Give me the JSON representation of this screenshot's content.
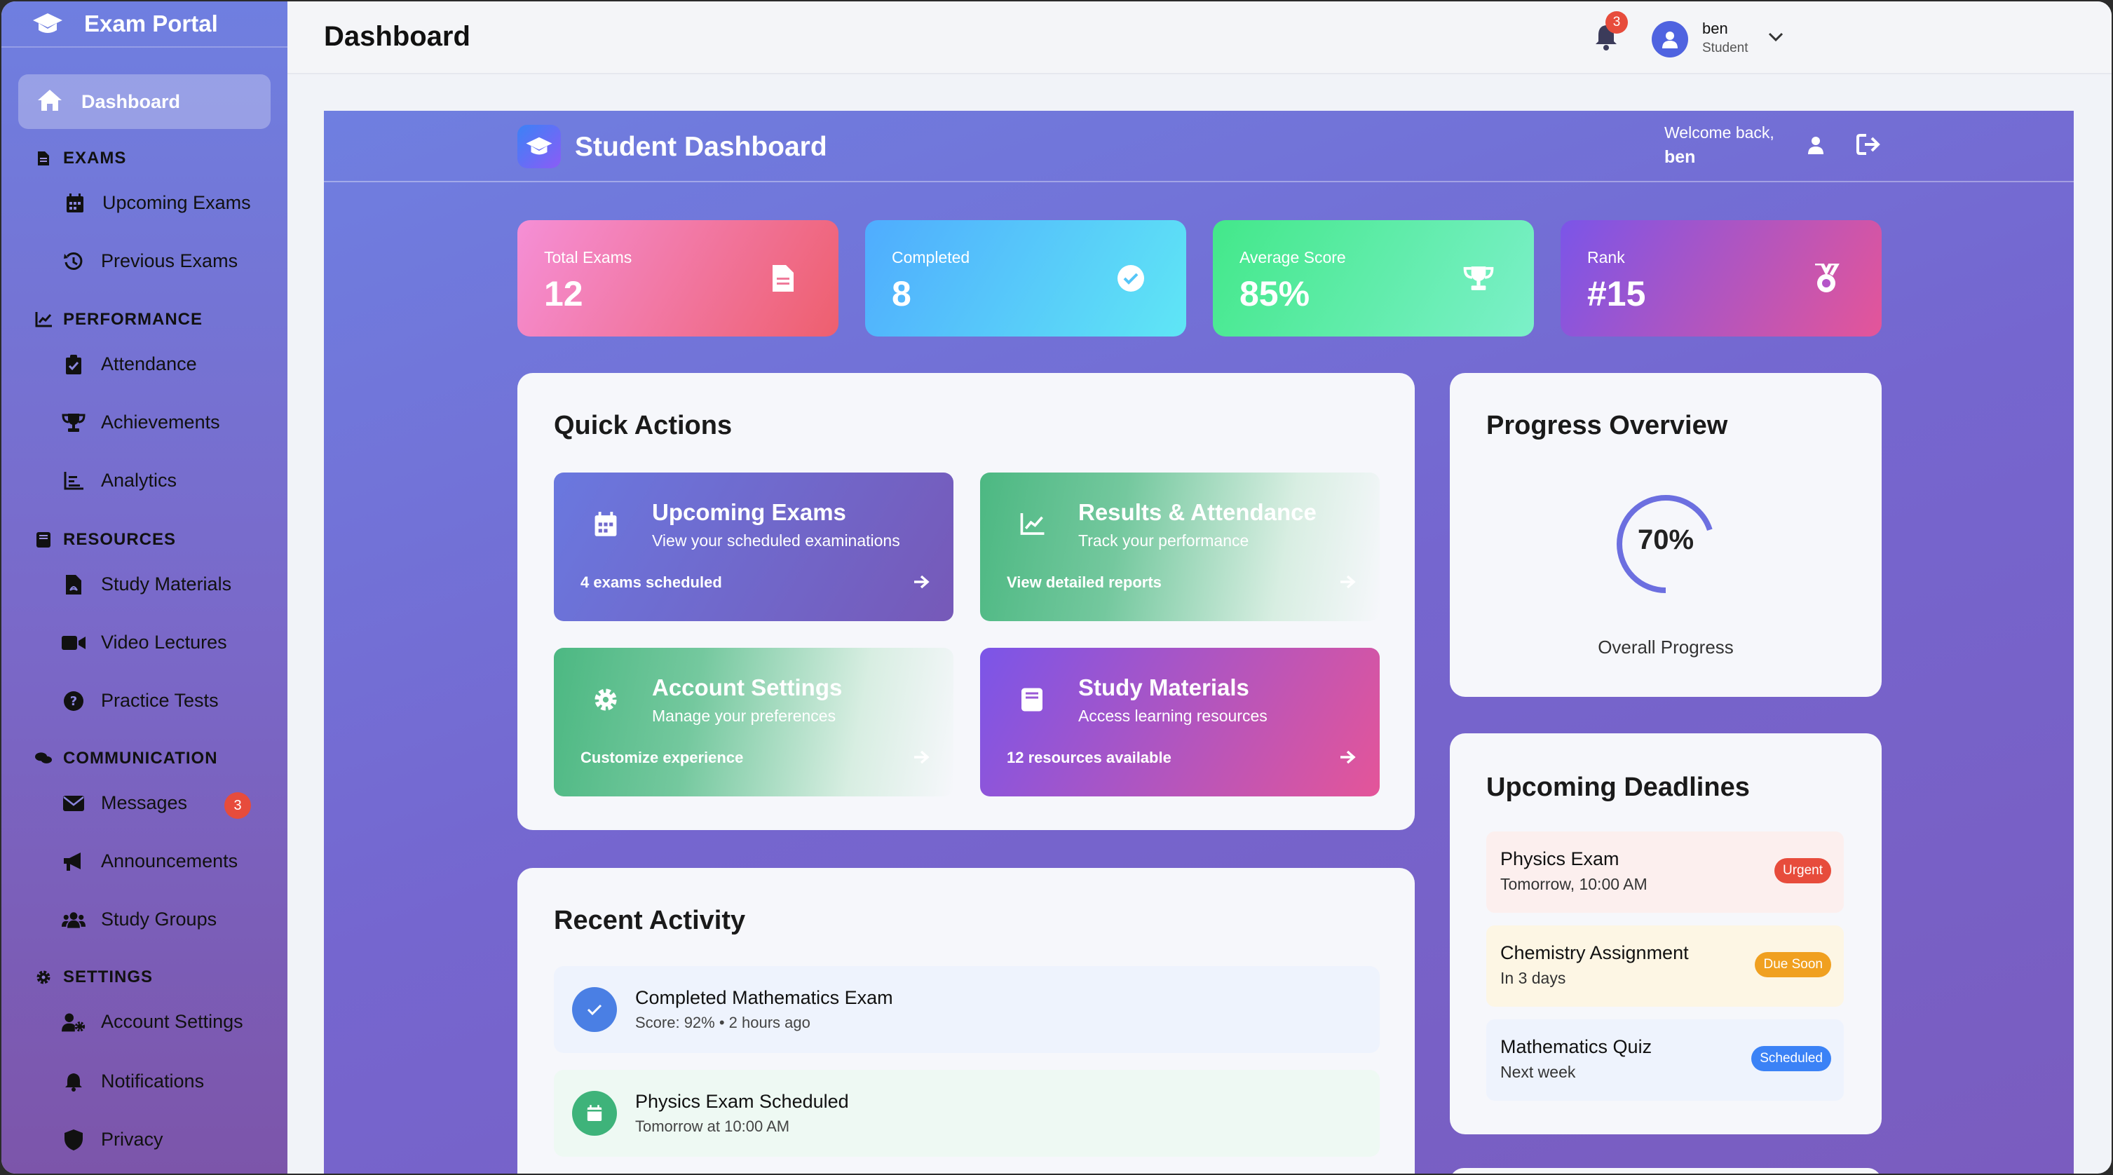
{
  "brand": {
    "name": "Exam Portal"
  },
  "sidebar": {
    "active": {
      "label": "Dashboard",
      "icon": "home-icon"
    },
    "sections": [
      {
        "title": "EXAMS",
        "icon": "file-icon",
        "items": [
          {
            "label": "Upcoming Exams",
            "icon": "calendar-icon"
          },
          {
            "label": "Previous Exams",
            "icon": "history-icon"
          }
        ]
      },
      {
        "title": "PERFORMANCE",
        "icon": "chart-line-icon",
        "items": [
          {
            "label": "Attendance",
            "icon": "clipboard-check-icon"
          },
          {
            "label": "Achievements",
            "icon": "trophy-icon"
          },
          {
            "label": "Analytics",
            "icon": "bar-chart-icon"
          }
        ]
      },
      {
        "title": "RESOURCES",
        "icon": "book-icon",
        "items": [
          {
            "label": "Study Materials",
            "icon": "file-pdf-icon"
          },
          {
            "label": "Video Lectures",
            "icon": "video-icon"
          },
          {
            "label": "Practice Tests",
            "icon": "question-circle-icon"
          }
        ]
      },
      {
        "title": "COMMUNICATION",
        "icon": "comments-icon",
        "items": [
          {
            "label": "Messages",
            "icon": "envelope-icon",
            "badge": "3"
          },
          {
            "label": "Announcements",
            "icon": "bullhorn-icon"
          },
          {
            "label": "Study Groups",
            "icon": "users-icon"
          }
        ]
      },
      {
        "title": "SETTINGS",
        "icon": "gear-icon",
        "items": [
          {
            "label": "Account Settings",
            "icon": "user-cog-icon"
          },
          {
            "label": "Notifications",
            "icon": "bell-icon"
          },
          {
            "label": "Privacy",
            "icon": "shield-icon"
          }
        ]
      }
    ]
  },
  "topbar": {
    "title": "Dashboard",
    "notifications_count": "3",
    "user": {
      "name": "ben",
      "role": "Student"
    }
  },
  "dashboard": {
    "title": "Student Dashboard",
    "welcome": "Welcome back,",
    "username": "ben"
  },
  "stats": [
    {
      "label": "Total Exams",
      "value": "12",
      "icon": "file-icon",
      "gradient": [
        "#f58fd6",
        "#ee5f6e"
      ]
    },
    {
      "label": "Completed",
      "value": "8",
      "icon": "check-circle-icon",
      "gradient": [
        "#4facfe",
        "#5fe6f5"
      ]
    },
    {
      "label": "Average Score",
      "value": "85%",
      "icon": "trophy-icon",
      "gradient": [
        "#43e88a",
        "#7cf0c9"
      ]
    },
    {
      "label": "Rank",
      "value": "#15",
      "icon": "medal-icon",
      "gradient": [
        "#7b55e8",
        "#e45599"
      ]
    }
  ],
  "quick_actions": {
    "title": "Quick Actions",
    "items": [
      {
        "title": "Upcoming Exams",
        "subtitle": "View your scheduled examinations",
        "footer": "4 exams scheduled",
        "icon": "calendar-icon"
      },
      {
        "title": "Results & Attendance",
        "subtitle": "Track your performance",
        "footer": "View detailed reports",
        "icon": "chart-line-icon"
      },
      {
        "title": "Account Settings",
        "subtitle": "Manage your preferences",
        "footer": "Customize experience",
        "icon": "gear-icon"
      },
      {
        "title": "Study Materials",
        "subtitle": "Access learning resources",
        "footer": "12 resources available",
        "icon": "book-icon"
      }
    ]
  },
  "progress": {
    "title": "Progress Overview",
    "percent_label": "70%",
    "fraction": 0.7,
    "caption": "Overall Progress"
  },
  "recent_activity": {
    "title": "Recent Activity",
    "items": [
      {
        "title": "Completed Mathematics Exam",
        "subtitle": "Score: 92% • 2 hours ago",
        "icon": "check-icon"
      },
      {
        "title": "Physics Exam Scheduled",
        "subtitle": "Tomorrow at 10:00 AM",
        "icon": "calendar-icon"
      }
    ]
  },
  "deadlines": {
    "title": "Upcoming Deadlines",
    "items": [
      {
        "title": "Physics Exam",
        "subtitle": "Tomorrow, 10:00 AM",
        "badge": "Urgent",
        "color": "#e74c3c"
      },
      {
        "title": "Chemistry Assignment",
        "subtitle": "In 3 days",
        "badge": "Due Soon",
        "color": "#f0a020"
      },
      {
        "title": "Mathematics Quiz",
        "subtitle": "Next week",
        "badge": "Scheduled",
        "color": "#3b82f6"
      }
    ]
  }
}
